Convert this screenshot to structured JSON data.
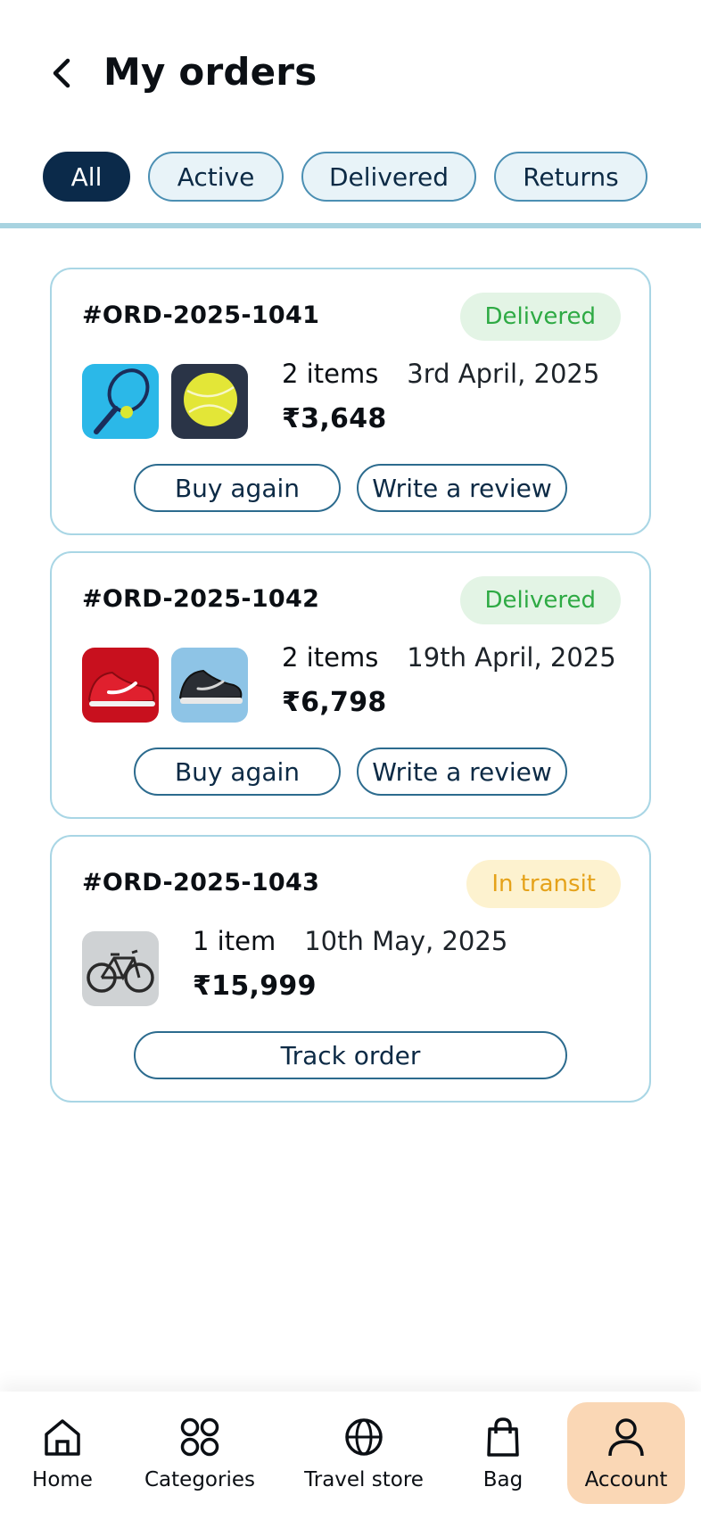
{
  "header": {
    "title": "My orders"
  },
  "tabs": [
    {
      "label": "All"
    },
    {
      "label": "Active"
    },
    {
      "label": "Delivered"
    },
    {
      "label": "Returns"
    }
  ],
  "orders": [
    {
      "id": "#ORD-2025-1041",
      "status": "Delivered",
      "items": "2 items",
      "date": "3rd April, 2025",
      "price": "₹3,648",
      "thumbnails": [
        "tennis-racket",
        "tennis-ball"
      ],
      "actions": [
        "Buy again",
        "Write a review"
      ]
    },
    {
      "id": "#ORD-2025-1042",
      "status": "Delivered",
      "items": "2 items",
      "date": "19th April, 2025",
      "price": "₹6,798",
      "thumbnails": [
        "red-running-shoe",
        "black-basketball-shoe"
      ],
      "actions": [
        "Buy again",
        "Write a review"
      ]
    },
    {
      "id": "#ORD-2025-1043",
      "status": "In transit",
      "items": "1 item",
      "date": "10th May, 2025",
      "price": "₹15,999",
      "thumbnails": [
        "bicycle"
      ],
      "actions": [
        "Track order"
      ]
    }
  ],
  "nav": [
    {
      "label": "Home",
      "icon": "home-icon"
    },
    {
      "label": "Categories",
      "icon": "categories-icon"
    },
    {
      "label": "Travel store",
      "icon": "globe-icon"
    },
    {
      "label": "Bag",
      "icon": "bag-icon"
    },
    {
      "label": "Account",
      "icon": "account-icon",
      "active": true
    }
  ],
  "colors": {
    "primary_dark": "#0b2a4a",
    "accent_border": "#a9d6e5",
    "delivered_text": "#2eaa44",
    "delivered_bg": "#e3f4e5",
    "transit_text": "#e5a21a",
    "transit_bg": "#fdf2cf",
    "nav_active_bg": "#fad7b5"
  }
}
